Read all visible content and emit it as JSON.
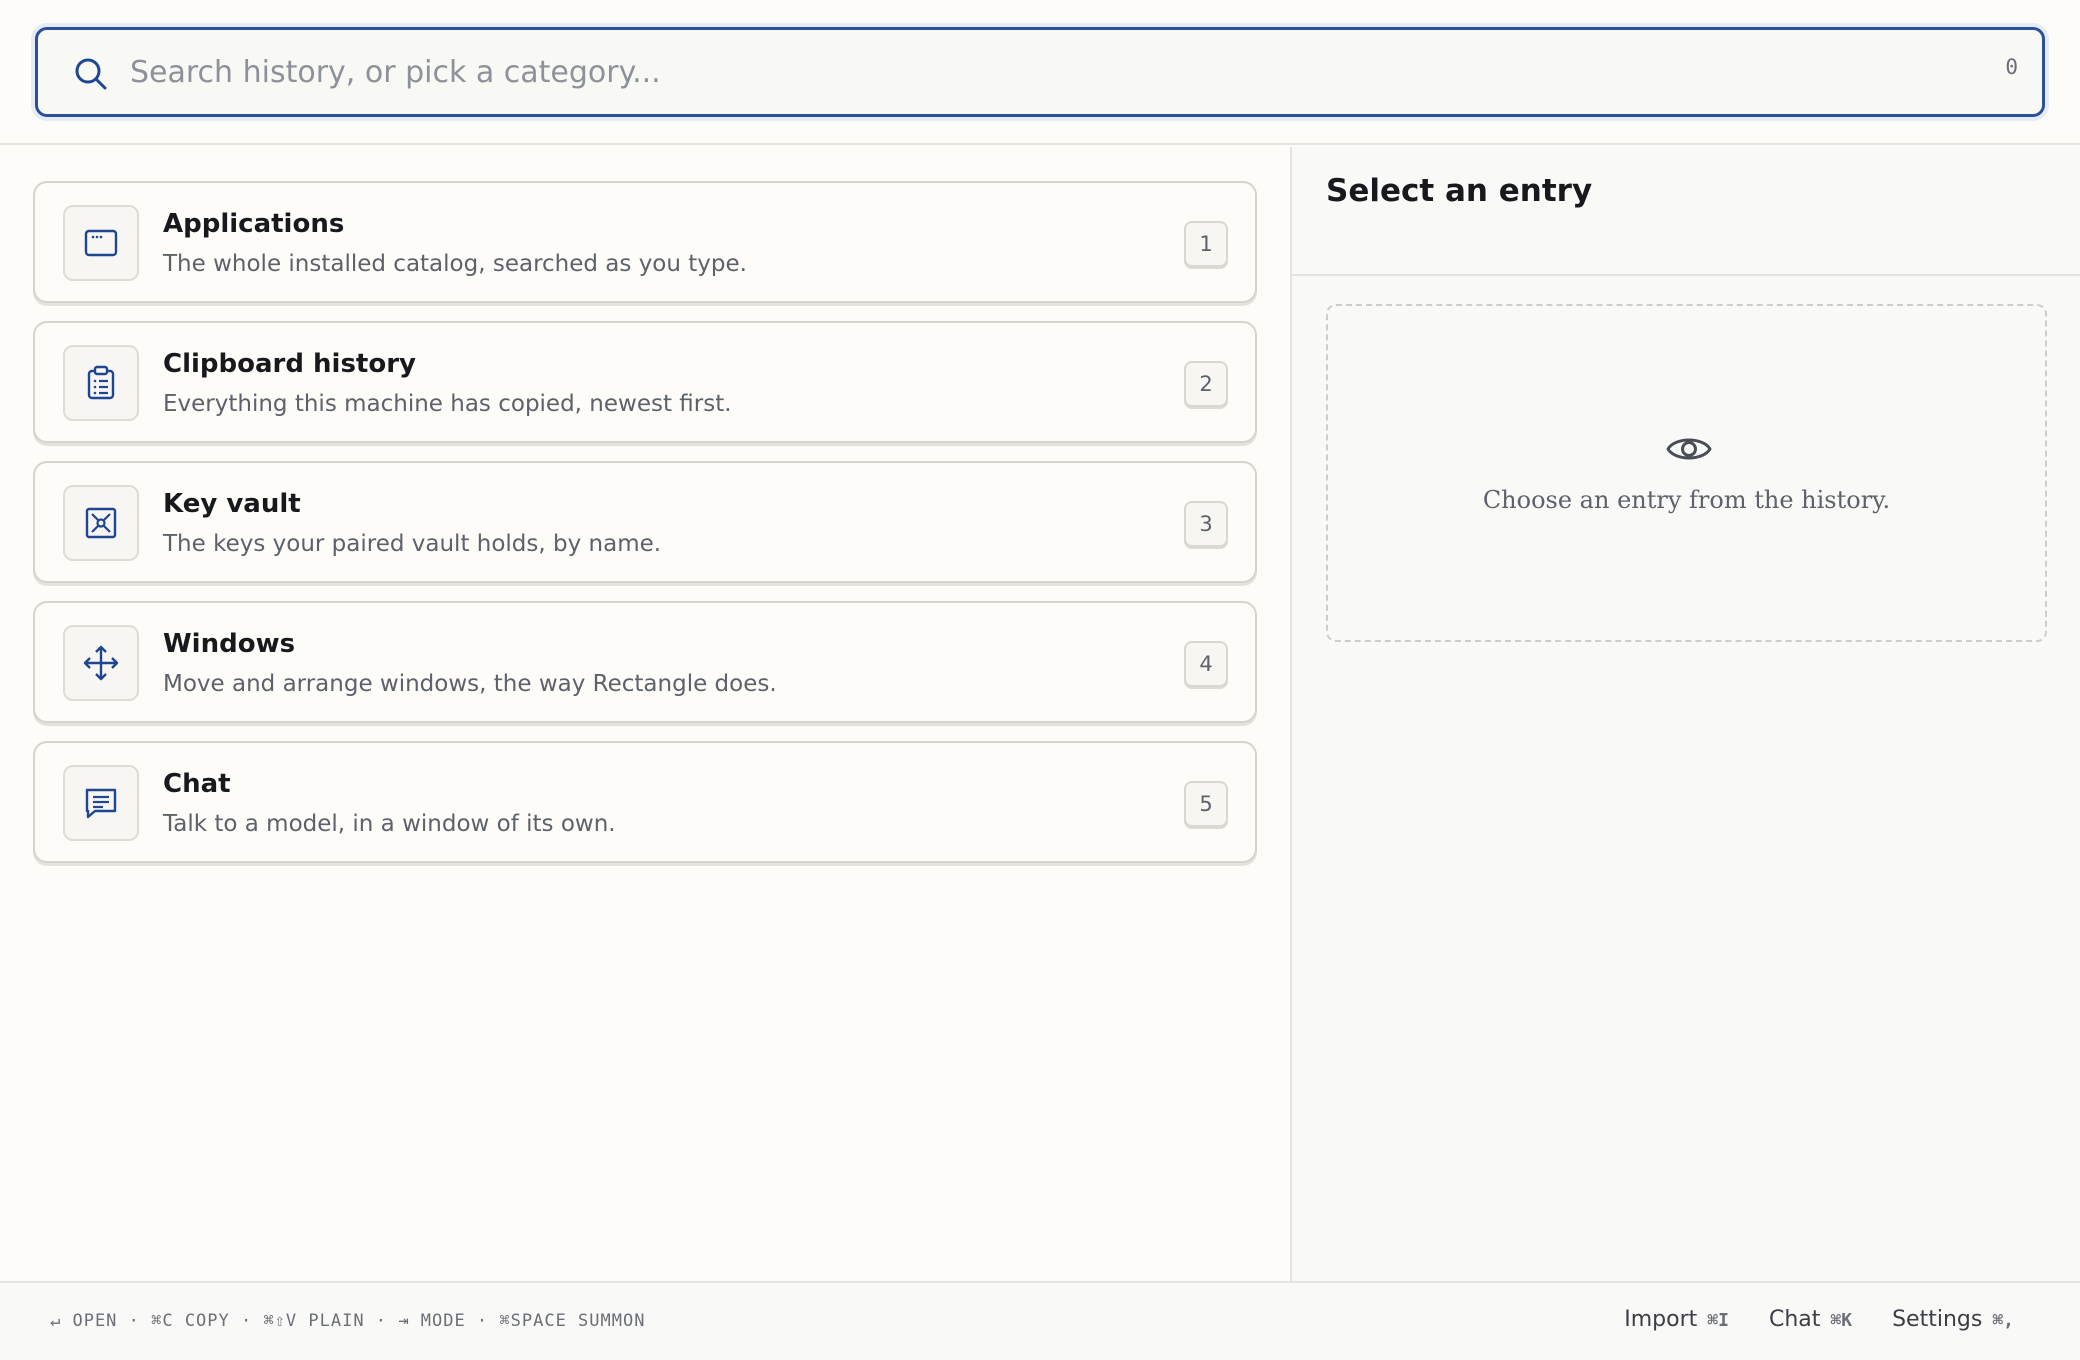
{
  "search": {
    "placeholder": "Search history, or pick a category...",
    "count": "0"
  },
  "categories": [
    {
      "title": "Applications",
      "description": "The whole installed catalog, searched as you type.",
      "key": "1",
      "icon": "window-icon"
    },
    {
      "title": "Clipboard history",
      "description": "Everything this machine has copied, newest first.",
      "key": "2",
      "icon": "clipboard-icon"
    },
    {
      "title": "Key vault",
      "description": "The keys your paired vault holds, by name.",
      "key": "3",
      "icon": "vault-icon"
    },
    {
      "title": "Windows",
      "description": "Move and arrange windows, the way Rectangle does.",
      "key": "4",
      "icon": "move-arrows-icon"
    },
    {
      "title": "Chat",
      "description": "Talk to a model, in a window of its own.",
      "key": "5",
      "icon": "chat-bubble-icon"
    }
  ],
  "preview": {
    "title": "Select an entry",
    "empty_text": "Choose an entry from the history.",
    "icon": "eye-icon"
  },
  "footer": {
    "hints": "↵ OPEN · ⌘C COPY · ⌘⇧V PLAIN · ⇥ MODE · ⌘SPACE SUMMON",
    "actions": [
      {
        "label": "Import",
        "shortcut": "⌘I"
      },
      {
        "label": "Chat",
        "shortcut": "⌘K"
      },
      {
        "label": "Settings",
        "shortcut": "⌘,"
      }
    ]
  },
  "colors": {
    "accent": "#2c4f9a",
    "icon": "#1f4690",
    "background": "#fdfcf9"
  }
}
